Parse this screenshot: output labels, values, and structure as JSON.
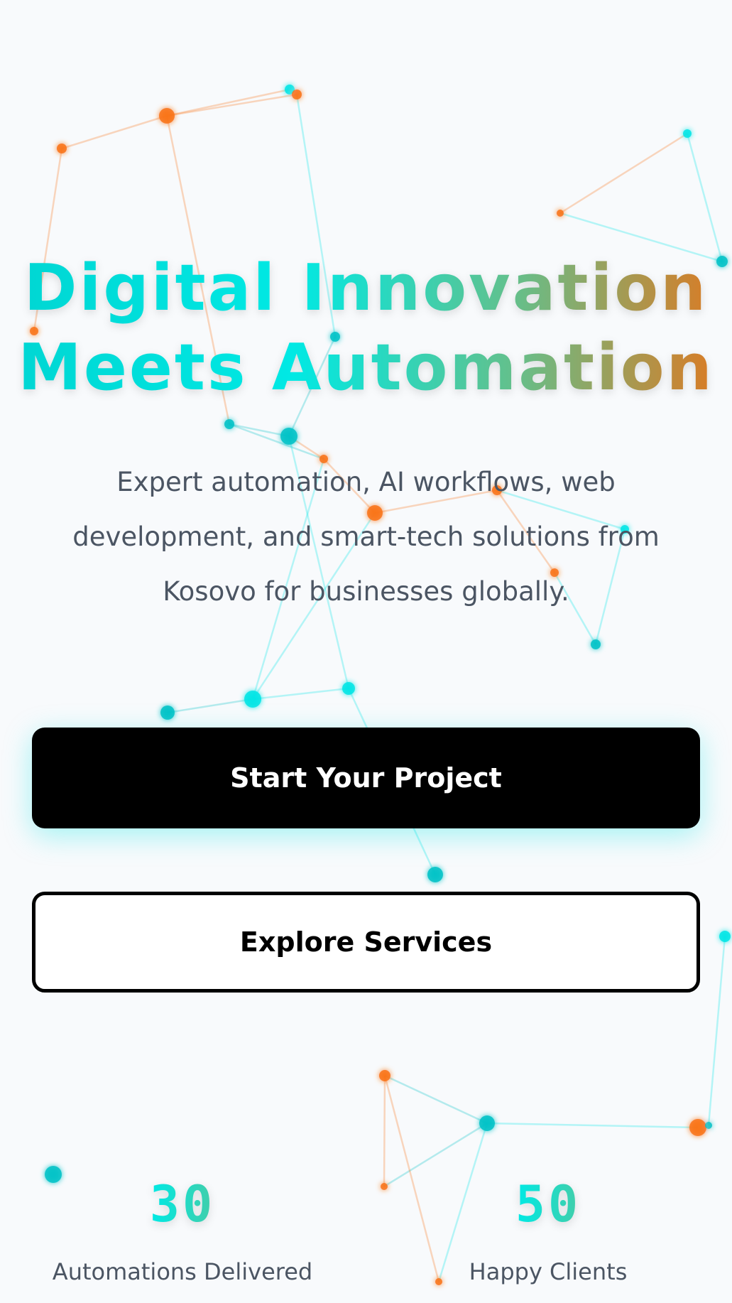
{
  "hero": {
    "headline_line1": "Digital Innovation",
    "headline_line2": "Meets Automation",
    "subtitle": "Expert automation, AI workflows, web development, and smart-tech solutions from Kosovo for businesses globally.",
    "primary_cta": "Start Your Project",
    "secondary_cta": "Explore Services"
  },
  "stats": [
    {
      "value": "30",
      "label": "Automations Delivered"
    },
    {
      "value": "50",
      "label": "Happy Clients"
    }
  ],
  "colors": {
    "cyan": "#00e5e5",
    "teal": "#00c2c7",
    "orange": "#f97316",
    "text_muted": "#4b5563",
    "background": "#f8fafc"
  }
}
